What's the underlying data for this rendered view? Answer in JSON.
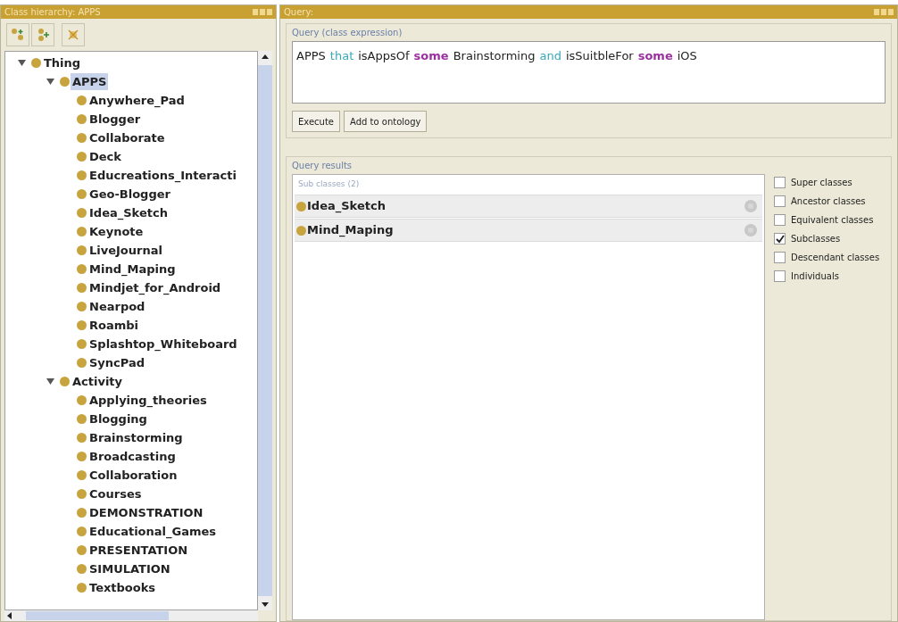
{
  "left_panel": {
    "title": "Class hierarchy: APPS",
    "tree": [
      {
        "label": "Thing",
        "selected": false,
        "expanded": true,
        "children": [
          {
            "label": "APPS",
            "selected": true,
            "expanded": true,
            "children": [
              {
                "label": "Anywhere_Pad",
                "selected": false
              },
              {
                "label": "Blogger",
                "selected": false
              },
              {
                "label": "Collaborate",
                "selected": false
              },
              {
                "label": "Deck",
                "selected": false
              },
              {
                "label": "Educreations_Interacti",
                "selected": false
              },
              {
                "label": "Geo-Blogger",
                "selected": false
              },
              {
                "label": "Idea_Sketch",
                "selected": false
              },
              {
                "label": "Keynote",
                "selected": false
              },
              {
                "label": "LiveJournal",
                "selected": false
              },
              {
                "label": "Mind_Maping",
                "selected": false
              },
              {
                "label": "Mindjet_for_Android",
                "selected": false
              },
              {
                "label": "Nearpod",
                "selected": false
              },
              {
                "label": "Roambi",
                "selected": false
              },
              {
                "label": "Splashtop_Whiteboard",
                "selected": false
              },
              {
                "label": "SyncPad",
                "selected": false
              }
            ]
          },
          {
            "label": "Activity",
            "selected": false,
            "expanded": true,
            "children": [
              {
                "label": "Applying_theories",
                "selected": false
              },
              {
                "label": "Blogging",
                "selected": false
              },
              {
                "label": "Brainstorming",
                "selected": false
              },
              {
                "label": "Broadcasting",
                "selected": false
              },
              {
                "label": "Collaboration",
                "selected": false
              },
              {
                "label": "Courses",
                "selected": false
              },
              {
                "label": "DEMONSTRATION",
                "selected": false
              },
              {
                "label": "Educational_Games",
                "selected": false
              },
              {
                "label": "PRESENTATION",
                "selected": false
              },
              {
                "label": "SIMULATION",
                "selected": false
              },
              {
                "label": "Textbooks",
                "selected": false
              }
            ]
          }
        ]
      }
    ]
  },
  "query_panel": {
    "title": "Query:",
    "expression_group": {
      "title": "Query (class expression)",
      "expression": [
        {
          "text": "APPS",
          "kind": "name"
        },
        {
          "text": "that",
          "kind": "connective"
        },
        {
          "text": "isAppsOf",
          "kind": "name"
        },
        {
          "text": "some",
          "kind": "quantifier"
        },
        {
          "text": "Brainstorming",
          "kind": "name"
        },
        {
          "text": "and",
          "kind": "connective"
        },
        {
          "text": "isSuitbleFor",
          "kind": "name"
        },
        {
          "text": "some",
          "kind": "quantifier"
        },
        {
          "text": "iOS",
          "kind": "name"
        }
      ],
      "buttons": [
        "Execute",
        "Add to ontology"
      ]
    },
    "results_group": {
      "title": "Query results",
      "list_header": "Sub classes (2)",
      "results": [
        {
          "label": "Idea_Sketch"
        },
        {
          "label": "Mind_Maping"
        }
      ],
      "options": [
        {
          "label": "Super classes",
          "checked": false
        },
        {
          "label": "Ancestor classes",
          "checked": false
        },
        {
          "label": "Equivalent classes",
          "checked": false
        },
        {
          "label": "Subclasses",
          "checked": true
        },
        {
          "label": "Descendant classes",
          "checked": false
        },
        {
          "label": "Individuals",
          "checked": false
        }
      ]
    }
  }
}
